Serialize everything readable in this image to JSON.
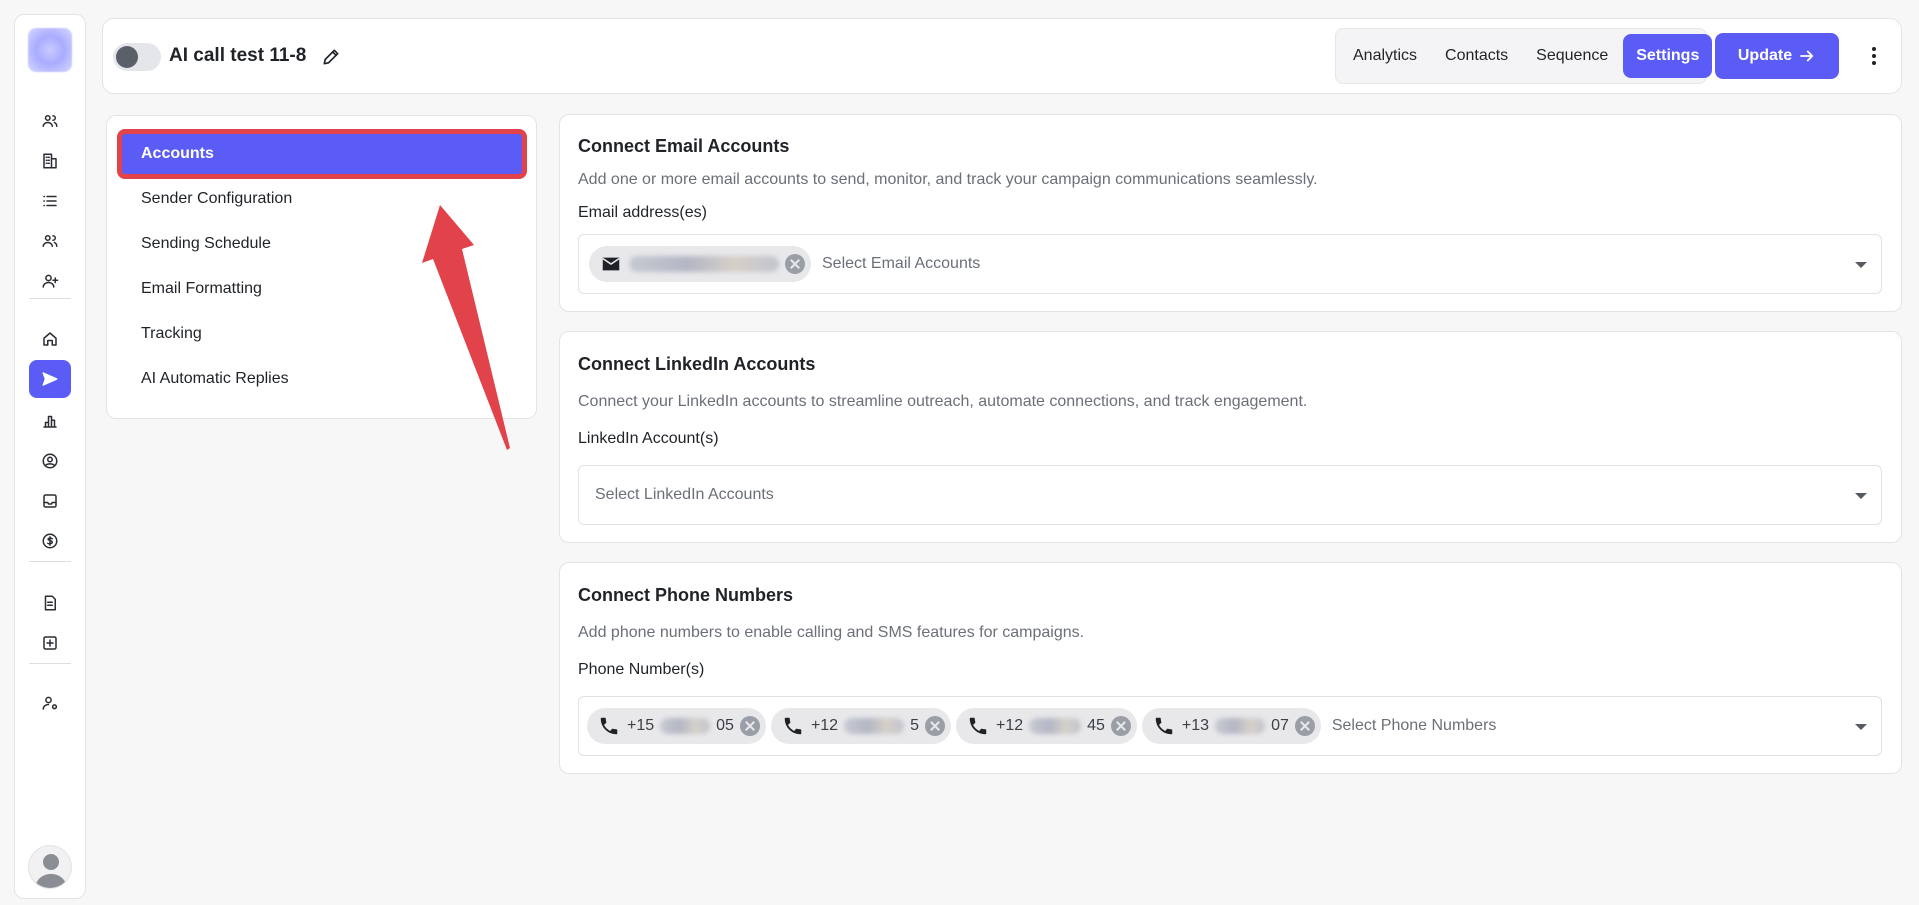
{
  "header": {
    "campaign_title": "AI call test 11-8",
    "tabs": [
      {
        "label": "Analytics",
        "active": false
      },
      {
        "label": "Contacts",
        "active": false
      },
      {
        "label": "Sequence",
        "active": false
      },
      {
        "label": "Settings",
        "active": true
      }
    ],
    "update_label": "Update",
    "active_status": "off"
  },
  "settings_nav": {
    "items": [
      {
        "label": "Accounts",
        "active": true
      },
      {
        "label": "Sender Configuration",
        "active": false
      },
      {
        "label": "Sending Schedule",
        "active": false
      },
      {
        "label": "Email Formatting",
        "active": false
      },
      {
        "label": "Tracking",
        "active": false
      },
      {
        "label": "AI Automatic Replies",
        "active": false
      }
    ]
  },
  "email_section": {
    "title": "Connect Email Accounts",
    "description": "Add one or more email accounts to send, monitor, and track your campaign communications seamlessly.",
    "field_label": "Email address(es)",
    "placeholder": "Select Email Accounts",
    "chips": [
      {
        "icon": "mail-icon"
      }
    ]
  },
  "linkedin_section": {
    "title": "Connect LinkedIn Accounts",
    "description": "Connect your LinkedIn accounts to streamline outreach, automate connections, and track engagement.",
    "field_label": "LinkedIn Account(s)",
    "placeholder": "Select LinkedIn Accounts"
  },
  "phone_section": {
    "title": "Connect Phone Numbers",
    "description": "Add phone numbers to enable calling and SMS features for campaigns.",
    "field_label": "Phone Number(s)",
    "placeholder": "Select Phone Numbers",
    "chips": [
      {
        "prefix": "+15",
        "suffix": "05"
      },
      {
        "prefix": "+12",
        "suffix": "5"
      },
      {
        "prefix": "+12",
        "suffix": "45"
      },
      {
        "prefix": "+13",
        "suffix": "07"
      }
    ]
  },
  "colors": {
    "accent": "#5b5cf6",
    "annotation": "#e2434a"
  }
}
